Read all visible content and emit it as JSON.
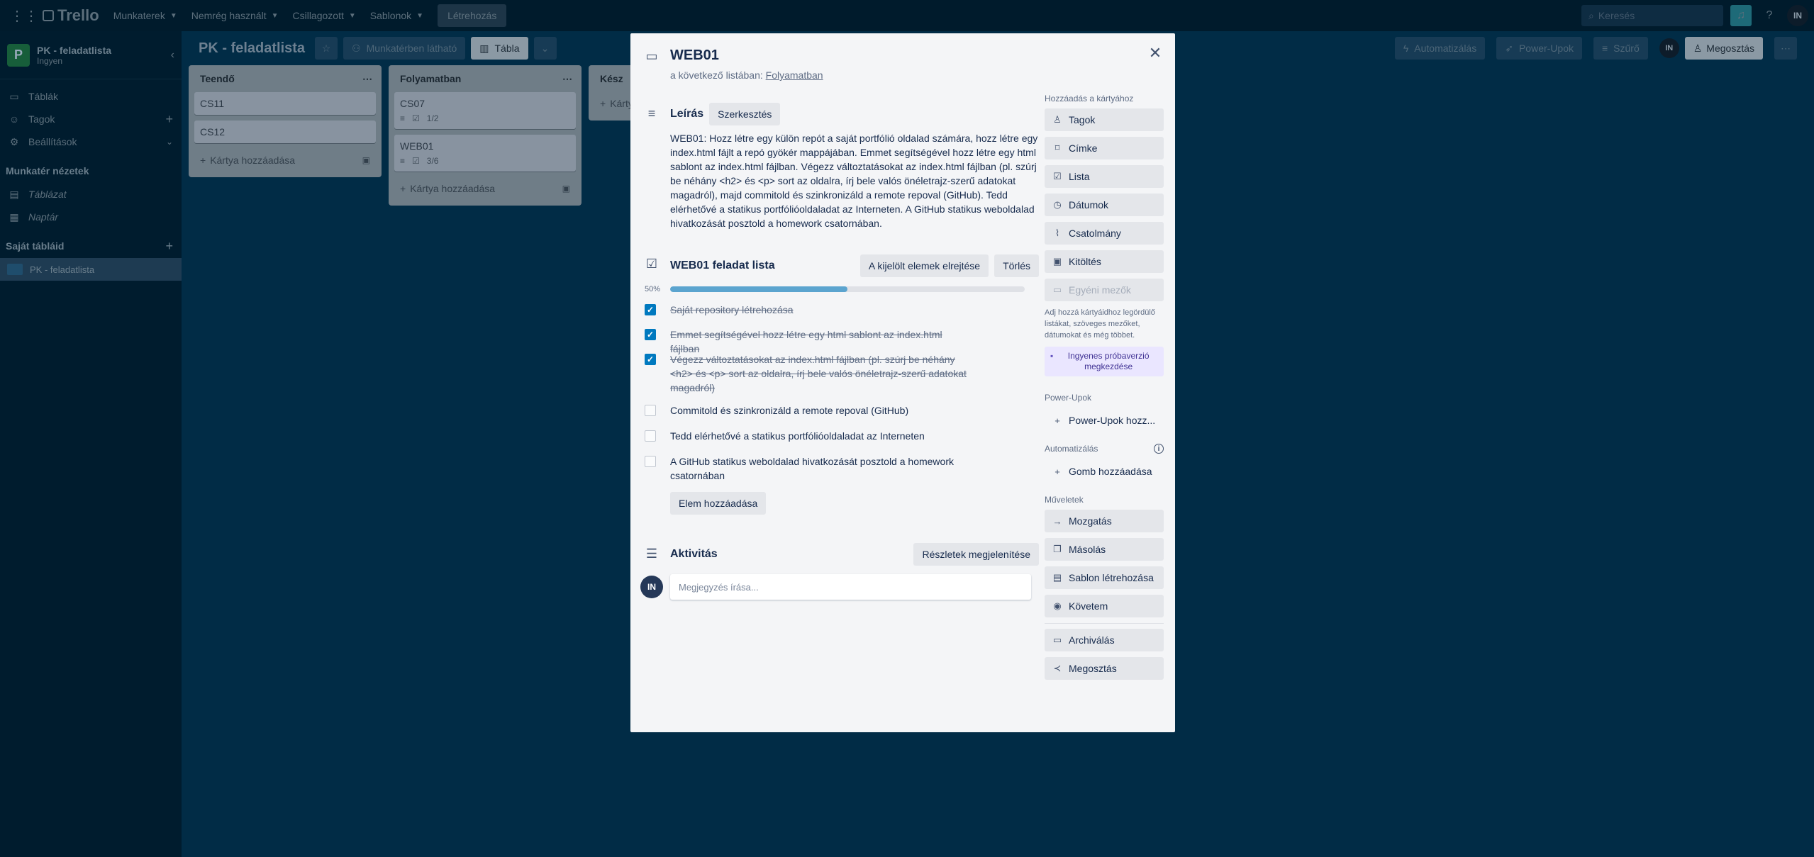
{
  "topbar": {
    "logo": "Trello",
    "menus": [
      "Munkaterek",
      "Nemrég használt",
      "Csillagozott",
      "Sablonok"
    ],
    "create": "Létrehozás",
    "search_placeholder": "Keresés",
    "avatar": "IN"
  },
  "sidebar": {
    "workspace_initial": "P",
    "workspace_name": "PK - feladatlista",
    "workspace_plan": "Ingyen",
    "items": [
      "Táblák",
      "Tagok",
      "Beállítások"
    ],
    "views_title": "Munkatér nézetek",
    "views": [
      "Táblázat",
      "Naptár"
    ],
    "boards_title": "Saját tábláid",
    "boards": [
      "PK - feladatlista"
    ]
  },
  "board_header": {
    "title": "PK - feladatlista",
    "visibility": "Munkatérben látható",
    "view": "Tábla",
    "automation": "Automatizálás",
    "power_ups": "Power-Upok",
    "filter": "Szűrő",
    "avatar": "IN",
    "share": "Megosztás"
  },
  "lists": [
    {
      "title": "Teendő",
      "cards": [
        {
          "title": "CS11"
        },
        {
          "title": "CS12"
        }
      ],
      "add": "Kártya hozzáadása"
    },
    {
      "title": "Folyamatban",
      "cards": [
        {
          "title": "CS07",
          "checklist": "1/2"
        },
        {
          "title": "WEB01",
          "checklist": "3/6"
        }
      ],
      "add": "Kártya hozzáadása"
    },
    {
      "title": "Kész",
      "add": "Kártya"
    }
  ],
  "modal": {
    "title": "WEB01",
    "in_list_prefix": "a következő listában:",
    "in_list": "Folyamatban",
    "description_title": "Leírás",
    "edit": "Szerkesztés",
    "description": "WEB01: Hozz létre egy külön repót a saját portfólió oldalad számára, hozz létre egy index.html fájlt a repó gyökér mappájában. Emmet segítségével hozz létre egy html sablont az index.html fájlban. Végezz változtatásokat az index.html fájlban (pl. szúrj be néhány <h2> és <p> sort az oldalra, írj bele valós önéletrajz-szerű adatokat magadról), majd commitold és szinkronizáld a remote repoval (GitHub). Tedd elérhetővé a statikus portfólióoldaladat az Interneten. A GitHub statikus weboldalad hivatkozását posztold a homework csatornában.",
    "checklist_title": "WEB01 feladat lista",
    "hide_checked": "A kijelölt elemek elrejtése",
    "delete": "Törlés",
    "progress_label": "50%",
    "progress": 0.5,
    "items": [
      {
        "text": "Saját repository létrehozása",
        "done": true
      },
      {
        "text": "Emmet segítségével hozz létre egy html sablont az index.html fájlban",
        "done": true
      },
      {
        "text": "Végezz változtatásokat az index.html fájlban (pl. szúrj be néhány <h2> és <p> sort az oldalra, írj bele valós önéletrajz-szerű adatokat magadról)",
        "done": true
      },
      {
        "text": "Commitold és szinkronizáld a remote repoval (GitHub)",
        "done": false
      },
      {
        "text": "Tedd elérhetővé a statikus portfólióoldaladat az Interneten",
        "done": false
      },
      {
        "text": "A GitHub statikus weboldalad hivatkozását posztold a homework csatornában",
        "done": false
      }
    ],
    "add_item": "Elem hozzáadása",
    "activity_title": "Aktivitás",
    "show_details": "Részletek megjelenítése",
    "comment_avatar": "IN",
    "comment_placeholder": "Megjegyzés írása...",
    "side": {
      "add_title": "Hozzáadás a kártyához",
      "add_buttons": [
        "Tagok",
        "Címke",
        "Lista",
        "Dátumok",
        "Csatolmány",
        "Kitöltés",
        "Egyéni mezők"
      ],
      "custom_fields_hint": "Adj hozzá kártyáidhoz legördülő listákat, szöveges mezőket, dátumokat és még többet.",
      "trial": "Ingyenes próbaverzió megkezdése",
      "powerups_title": "Power-Upok",
      "powerups_add": "Power-Upok hozz...",
      "automation_title": "Automatizálás",
      "automation_add": "Gomb hozzáadása",
      "actions_title": "Műveletek",
      "actions": [
        "Mozgatás",
        "Másolás",
        "Sablon létrehozása",
        "Követem",
        "Archiválás",
        "Megosztás"
      ]
    }
  }
}
